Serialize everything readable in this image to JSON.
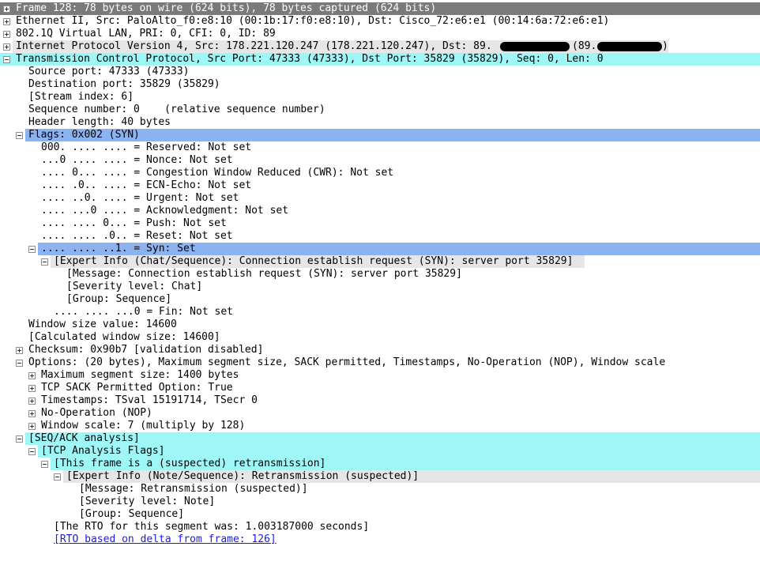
{
  "packet_tree": {
    "rows": [
      {
        "text": "Frame 128: 78 bytes on wire (624 bits), 78 bytes captured (624 bits)",
        "toggle": "plus",
        "highlight": "gray"
      },
      {
        "text": "Ethernet II, Src: PaloAlto_f0:e8:10 (00:1b:17:f0:e8:10), Dst: Cisco_72:e6:e1 (00:14:6a:72:e6:e1)",
        "toggle": "plus"
      },
      {
        "text": "802.1Q Virtual LAN, PRI: 0, CFI: 0, ID: 89",
        "toggle": "plus"
      },
      {
        "text": "Internet Protocol Version 4, Src: 178.221.120.247 (178.221.120.247), Dst: 89.",
        "toggle": "plus",
        "highlight": "lgray",
        "tail": "(89.",
        "suffix": ")"
      },
      {
        "text": "Transmission Control Protocol, Src Port: 47333 (47333), Dst Port: 35829 (35829), Seq: 0, Len: 0",
        "toggle": "minus",
        "highlight": "cyan"
      },
      {
        "text": "Source port: 47333 (47333)"
      },
      {
        "text": "Destination port: 35829 (35829)"
      },
      {
        "text": "[Stream index: 6]"
      },
      {
        "text": "Sequence number: 0    (relative sequence number)"
      },
      {
        "text": "Header length: 40 bytes"
      },
      {
        "text": "Flags: 0x002 (SYN)",
        "toggle": "minus",
        "highlight": "blue"
      },
      {
        "text": "000. .... .... = Reserved: Not set"
      },
      {
        "text": "...0 .... .... = Nonce: Not set"
      },
      {
        "text": ".... 0... .... = Congestion Window Reduced (CWR): Not set"
      },
      {
        "text": ".... .0.. .... = ECN-Echo: Not set"
      },
      {
        "text": ".... ..0. .... = Urgent: Not set"
      },
      {
        "text": ".... ...0 .... = Acknowledgment: Not set"
      },
      {
        "text": ".... .... 0... = Push: Not set"
      },
      {
        "text": ".... .... .0.. = Reset: Not set"
      },
      {
        "text": ".... .... ..1. = Syn: Set",
        "toggle": "minus",
        "highlight": "blue"
      },
      {
        "text": "[Expert Info (Chat/Sequence): Connection establish request (SYN): server port 35829]",
        "toggle": "minus",
        "highlight": "lgray"
      },
      {
        "text": "[Message: Connection establish request (SYN): server port 35829]"
      },
      {
        "text": "[Severity level: Chat]"
      },
      {
        "text": "[Group: Sequence]"
      },
      {
        "text": ".... .... ...0 = Fin: Not set"
      },
      {
        "text": "Window size value: 14600"
      },
      {
        "text": "[Calculated window size: 14600]"
      },
      {
        "text": "Checksum: 0x90b7 [validation disabled]",
        "toggle": "plus"
      },
      {
        "text": "Options: (20 bytes), Maximum segment size, SACK permitted, Timestamps, No-Operation (NOP), Window scale",
        "toggle": "minus"
      },
      {
        "text": "Maximum segment size: 1400 bytes",
        "toggle": "plus"
      },
      {
        "text": "TCP SACK Permitted Option: True",
        "toggle": "plus"
      },
      {
        "text": "Timestamps: TSval 15191714, TSecr 0",
        "toggle": "plus"
      },
      {
        "text": "No-Operation (NOP)",
        "toggle": "plus"
      },
      {
        "text": "Window scale: 7 (multiply by 128)",
        "toggle": "plus"
      },
      {
        "text": "[SEQ/ACK analysis]",
        "toggle": "minus",
        "highlight": "cyan"
      },
      {
        "text": "[TCP Analysis Flags]",
        "toggle": "minus",
        "highlight": "cyan"
      },
      {
        "text": "[This frame is a (suspected) retransmission]",
        "toggle": "minus",
        "highlight": "cyan"
      },
      {
        "text": "[Expert Info (Note/Sequence): Retransmission (suspected)]",
        "toggle": "minus",
        "highlight": "lgray"
      },
      {
        "text": "[Message: Retransmission (suspected)]"
      },
      {
        "text": "[Severity level: Note]"
      },
      {
        "text": "[Group: Sequence]"
      },
      {
        "text": "[The RTO for this segment was: 1.003187000 seconds]"
      },
      {
        "text": "[RTO based on delta from frame: 126]",
        "link": true
      }
    ]
  },
  "colors": {
    "selected_gray": "#7a7a7a",
    "cyan_highlight": "#9ff6f7",
    "blue_highlight": "#8cb3f0",
    "expert_gray": "#e6e6e6",
    "link": "#1a1aee"
  }
}
